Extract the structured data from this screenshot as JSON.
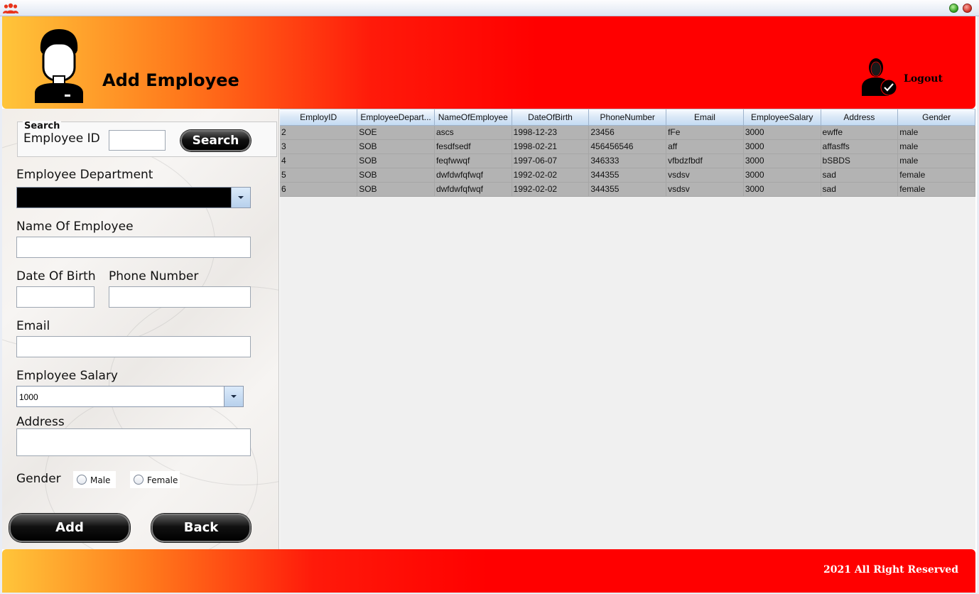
{
  "window": {
    "icon": "people-group-icon",
    "minimize_icon": "green-circle-icon",
    "close_icon": "red-circle-icon"
  },
  "header": {
    "title": "Add Employee",
    "logout_label": "Logout",
    "avatar_icon": "user-avatar-icon",
    "logout_icon": "user-check-icon"
  },
  "form": {
    "search": {
      "legend": "Search",
      "employee_id_label": "Employee ID",
      "employee_id_value": "",
      "search_button": "Search"
    },
    "department_label": "Employee Department",
    "department_value": "",
    "name_label": "Name Of Employee",
    "name_value": "",
    "dob_label": "Date Of Birth",
    "dob_value": "",
    "phone_label": "Phone Number",
    "phone_value": "",
    "email_label": "Email",
    "email_value": "",
    "salary_label": "Employee Salary",
    "salary_value": "1000",
    "address_label": "Address",
    "address_value": "",
    "gender_label": "Gender",
    "gender_options": [
      "Male",
      "Female"
    ],
    "add_button": "Add",
    "back_button": "Back"
  },
  "table": {
    "columns": [
      "EmployID",
      "EmployeeDepart...",
      "NameOfEmployee",
      "DateOfBirth",
      "PhoneNumber",
      "Email",
      "EmployeeSalary",
      "Address",
      "Gender"
    ],
    "rows": [
      [
        "2",
        "SOE",
        "ascs",
        "1998-12-23",
        "23456",
        "fFe",
        "3000",
        "ewffe",
        "male"
      ],
      [
        "3",
        "SOB",
        "fesdfsedf",
        "1998-02-21",
        "456456546",
        "aff",
        "3000",
        "affasffs",
        "male"
      ],
      [
        "4",
        "SOB",
        "feqfwwqf",
        "1997-06-07",
        "346333",
        "vfbdzfbdf",
        "3000",
        "bSBDS",
        "male"
      ],
      [
        "5",
        "SOB",
        "dwfdwfqfwqf",
        "1992-02-02",
        "344355",
        "vsdsv",
        "3000",
        "sad",
        "female"
      ],
      [
        "6",
        "SOB",
        "dwfdwfqfwqf",
        "1992-02-02",
        "344355",
        "vsdsv",
        "3000",
        "sad",
        "female"
      ]
    ]
  },
  "footer": {
    "text": "2021 All Right Reserved"
  },
  "colors": {
    "header_red": "#ff0000",
    "header_orange": "#ffc53a",
    "row_bg": "#b3b3b3",
    "header_cell": "#c4dbf3"
  }
}
